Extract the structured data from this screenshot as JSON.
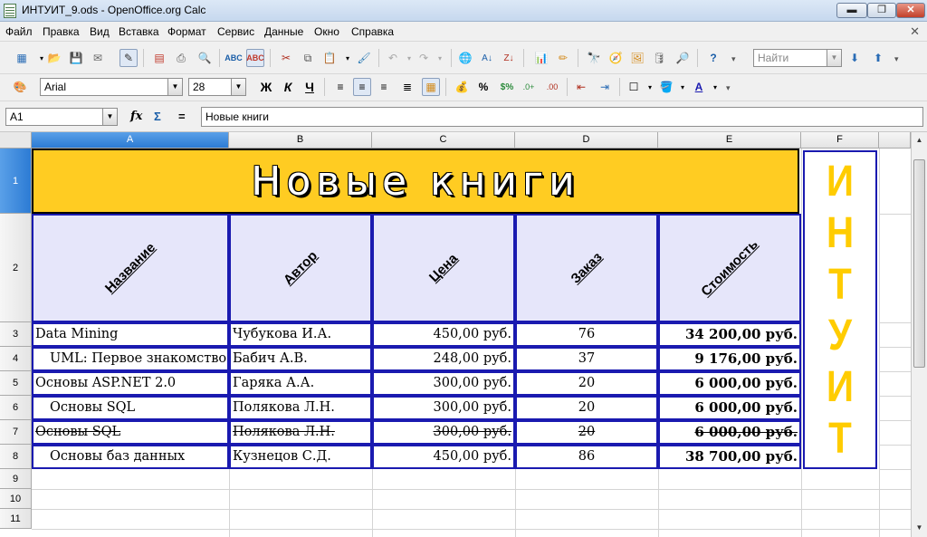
{
  "window": {
    "title": "ИНТУИТ_9.ods - OpenOffice.org Calc",
    "minimize": "▬",
    "maximize": "❐",
    "close": "✕"
  },
  "menu": [
    "Файл",
    "Правка",
    "Вид",
    "Вставка",
    "Формат",
    "Сервис",
    "Данные",
    "Окно",
    "Справка"
  ],
  "toolbar": {
    "find_placeholder": "Найти",
    "font_name": "Arial",
    "font_size": "28",
    "bold": "Ж",
    "italic": "К",
    "underline": "Ч"
  },
  "formula_bar": {
    "cell_ref": "A1",
    "fx": "fx",
    "sum": "Σ",
    "equals": "=",
    "content": "Новые книги"
  },
  "sheet": {
    "columns": [
      "A",
      "B",
      "C",
      "D",
      "E",
      "F"
    ],
    "rows": [
      "1",
      "2",
      "3",
      "4",
      "5",
      "6",
      "7",
      "8",
      "9",
      "10",
      "11"
    ],
    "title": "Новые книги",
    "headers": [
      "Название",
      "Автор",
      "Цена",
      "Заказ",
      "Стоимость"
    ],
    "data": [
      {
        "name": "Data Mining",
        "author": "Чубукова И.А.",
        "price": "450,00 руб.",
        "qty": "76",
        "total": "34 200,00 руб."
      },
      {
        "name": "UML: Первое знакомство",
        "author": "Бабич А.В.",
        "price": "248,00 руб.",
        "qty": "37",
        "total": "9 176,00 руб."
      },
      {
        "name": "Основы ASP.NET 2.0",
        "author": "Гаряка А.А.",
        "price": "300,00 руб.",
        "qty": "20",
        "total": "6 000,00 руб."
      },
      {
        "name": "Основы SQL",
        "author": "Полякова Л.Н.",
        "price": "300,00 руб.",
        "qty": "20",
        "total": "6 000,00 руб."
      },
      {
        "name": "Основы SQL",
        "author": "Полякова Л.Н.",
        "price": "300,00 руб.",
        "qty": "20",
        "total": "6 000,00 руб."
      },
      {
        "name": "Основы баз данных",
        "author": "Кузнецов С.Д.",
        "price": "450,00 руб.",
        "qty": "86",
        "total": "38 700,00 руб."
      }
    ],
    "vertical_text": [
      "И",
      "Н",
      "Т",
      "У",
      "И",
      "Т"
    ]
  },
  "colors": {
    "title_fill": "#ffcc22",
    "header_fill": "#e6e6fa",
    "border": "#1a1ab0",
    "vertical_text": "#ffcc00"
  }
}
